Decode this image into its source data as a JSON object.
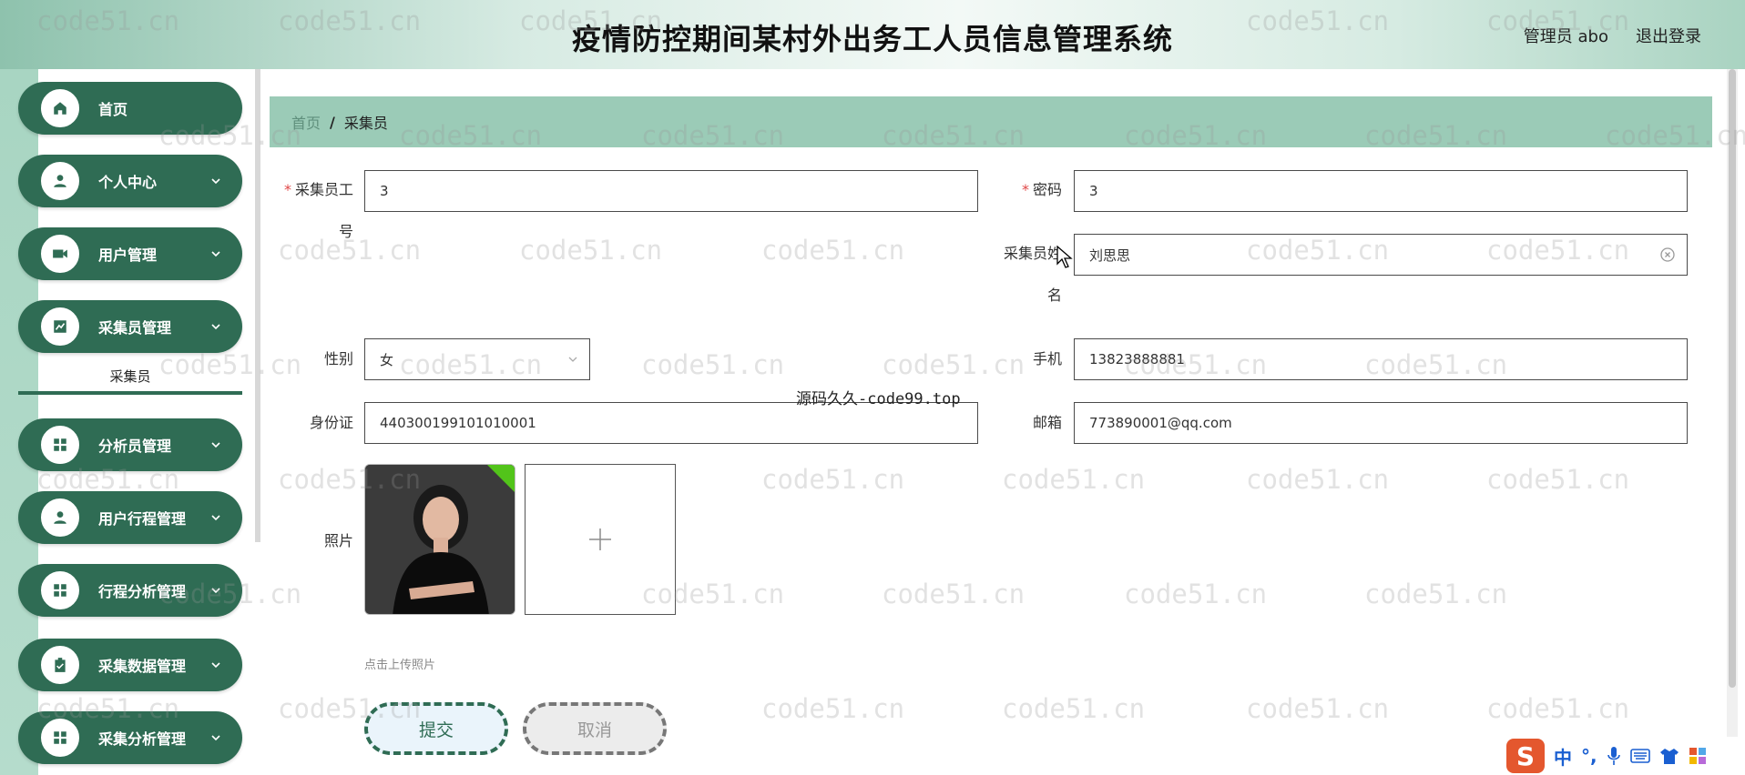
{
  "header": {
    "title": "疫情防控期间某村外出务工人员信息管理系统",
    "user": "管理员 abo",
    "logout": "退出登录"
  },
  "sidebar": {
    "items": [
      {
        "label": "首页",
        "icon": "home-icon"
      },
      {
        "label": "个人中心",
        "icon": "person-icon"
      },
      {
        "label": "用户管理",
        "icon": "video-icon"
      },
      {
        "label": "采集员管理",
        "icon": "chart-icon"
      },
      {
        "label": "分析员管理",
        "icon": "grid-icon"
      },
      {
        "label": "用户行程管理",
        "icon": "person-icon"
      },
      {
        "label": "行程分析管理",
        "icon": "grid-icon"
      },
      {
        "label": "采集数据管理",
        "icon": "clipboard-icon"
      },
      {
        "label": "采集分析管理",
        "icon": "grid-icon"
      }
    ],
    "sub_item": "采集员"
  },
  "breadcrumb": {
    "home": "首页",
    "separator": "/",
    "current": "采集员"
  },
  "form": {
    "id_label_1": "采集员工",
    "id_label_2": "号",
    "id_value": "3",
    "password_label": "密码",
    "password_value": "3",
    "name_label_1": "采集员姓",
    "name_label_2": "名",
    "name_value": "刘思思",
    "gender_label": "性别",
    "gender_value": "女",
    "phone_label": "手机",
    "phone_value": "13823888881",
    "idcard_label": "身份证",
    "idcard_value": "440300199101010001",
    "email_label": "邮箱",
    "email_value": "773890001@qq.com",
    "photo_label": "照片",
    "upload_hint": "点击上传照片",
    "required_mark": "*"
  },
  "buttons": {
    "submit": "提交",
    "cancel": "取消"
  },
  "watermarks": {
    "text": "code51.cn",
    "secondary": "源码久久-code99.top"
  },
  "ime": {
    "logo": "S",
    "mode": "中",
    "punct": "°,"
  },
  "colors": {
    "primary": "#2f6c54",
    "breadcrumb_bg": "#9bcbb7",
    "required": "#e04848"
  }
}
